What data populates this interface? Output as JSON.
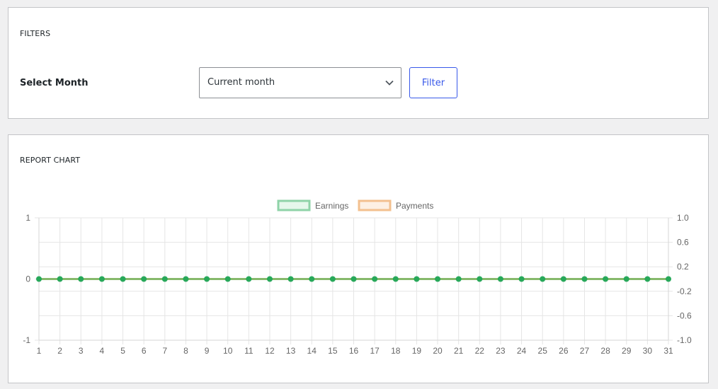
{
  "filters": {
    "title": "FILTERS",
    "select_month_label": "Select Month",
    "month_select": {
      "value": "Current month"
    },
    "filter_button": "Filter"
  },
  "report": {
    "title": "REPORT CHART"
  },
  "colors": {
    "earnings_border": "#8fd3a8",
    "earnings_fill": "#e6f7ec",
    "payments_border": "#f3c08f",
    "payments_fill": "#fdf0e4",
    "earnings_line": "#86b96b",
    "point": "#27a85a",
    "accent": "#3858e9"
  },
  "chart_data": {
    "type": "line",
    "title": "",
    "xlabel": "",
    "ylabel": "",
    "x": [
      1,
      2,
      3,
      4,
      5,
      6,
      7,
      8,
      9,
      10,
      11,
      12,
      13,
      14,
      15,
      16,
      17,
      18,
      19,
      20,
      21,
      22,
      23,
      24,
      25,
      26,
      27,
      28,
      29,
      30,
      31
    ],
    "x_tick_labels": [
      "1",
      "2",
      "3",
      "4",
      "5",
      "6",
      "7",
      "8",
      "9",
      "10",
      "11",
      "12",
      "13",
      "14",
      "15",
      "16",
      "17",
      "18",
      "19",
      "20",
      "21",
      "22",
      "23",
      "24",
      "25",
      "26",
      "27",
      "28",
      "29",
      "30",
      "31"
    ],
    "series": [
      {
        "name": "Earnings",
        "axis": "left",
        "values": [
          0,
          0,
          0,
          0,
          0,
          0,
          0,
          0,
          0,
          0,
          0,
          0,
          0,
          0,
          0,
          0,
          0,
          0,
          0,
          0,
          0,
          0,
          0,
          0,
          0,
          0,
          0,
          0,
          0,
          0,
          0
        ]
      },
      {
        "name": "Payments",
        "axis": "right",
        "values": [
          0,
          0,
          0,
          0,
          0,
          0,
          0,
          0,
          0,
          0,
          0,
          0,
          0,
          0,
          0,
          0,
          0,
          0,
          0,
          0,
          0,
          0,
          0,
          0,
          0,
          0,
          0,
          0,
          0,
          0,
          0
        ]
      }
    ],
    "y_left": {
      "ylim": [
        -1,
        1
      ],
      "ticks": [
        1,
        0,
        -1
      ],
      "tick_labels": [
        "1",
        "0",
        "-1"
      ]
    },
    "y_right": {
      "ylim": [
        -1,
        1
      ],
      "ticks": [
        1.0,
        0.6,
        0.2,
        -0.2,
        -0.6,
        -1.0
      ],
      "tick_labels": [
        "1.0",
        "0.6",
        "0.2",
        "-0.2",
        "-0.6",
        "-1.0"
      ]
    },
    "grid": true,
    "legend": {
      "position": "top",
      "entries": [
        "Earnings",
        "Payments"
      ]
    }
  }
}
